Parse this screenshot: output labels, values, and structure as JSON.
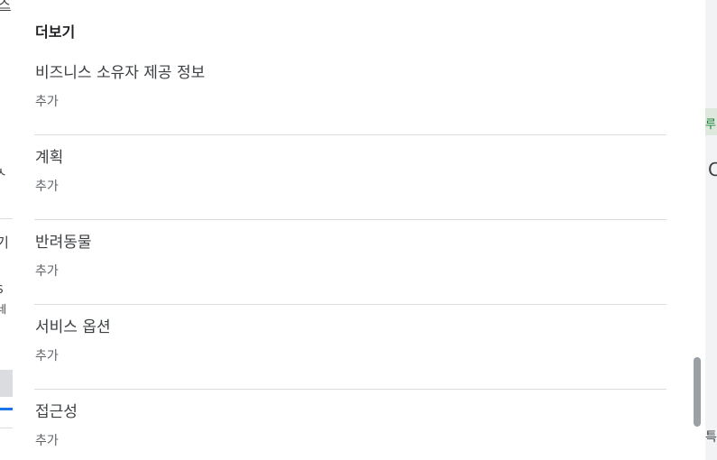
{
  "background": {
    "left_fragments": [
      "스",
      "ㅅ",
      "기",
      "S",
      "네"
    ],
    "right_fragments": [
      "루",
      "C",
      "특"
    ]
  },
  "panel": {
    "section_title": "더보기",
    "attributes": [
      {
        "name": "비즈니스 소유자 제공 정보",
        "action": "추가"
      },
      {
        "name": "계획",
        "action": "추가"
      },
      {
        "name": "반려동물",
        "action": "추가"
      },
      {
        "name": "서비스 옵션",
        "action": "추가"
      },
      {
        "name": "접근성",
        "action": "추가"
      }
    ]
  },
  "colors": {
    "divider": "#dadce0",
    "scroll_thumb": "#9aa0a6",
    "accent_blue": "#1a73e8"
  }
}
